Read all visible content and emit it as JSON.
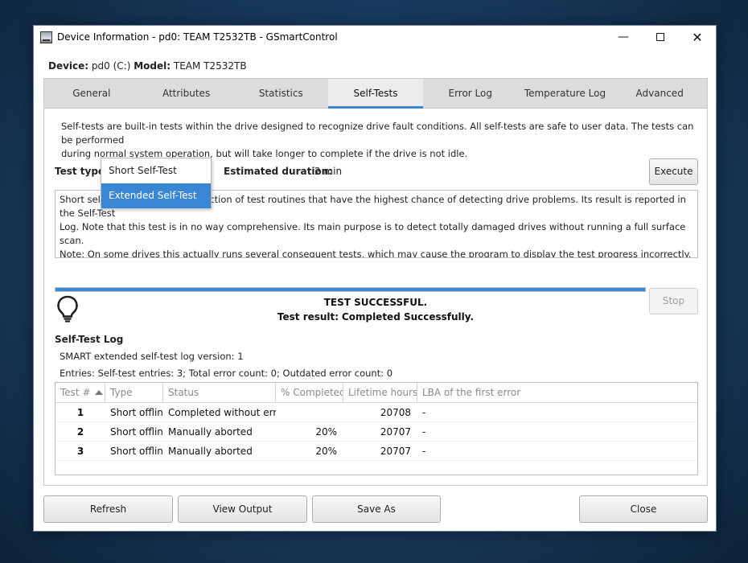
{
  "window": {
    "title": "Device Information - pd0: TEAM T2532TB - GSmartControl",
    "controls": {
      "minimize": "—",
      "close": "✕"
    }
  },
  "device": {
    "device_label": "Device:",
    "device_value": "pd0 (C:)",
    "model_label": "Model:",
    "model_value": "TEAM T2532TB"
  },
  "tabs": [
    {
      "label": "General"
    },
    {
      "label": "Attributes"
    },
    {
      "label": "Statistics"
    },
    {
      "label": "Self-Tests"
    },
    {
      "label": "Error Log"
    },
    {
      "label": "Temperature Log"
    },
    {
      "label": "Advanced"
    }
  ],
  "active_tab": "Self-Tests",
  "selftests": {
    "intro_line1": "Self-tests are built-in tests within the drive designed to recognize drive fault conditions. All self-tests are safe to user data. The tests can be performed",
    "intro_line2": "during normal system operation, but will take longer to complete if the drive is not idle.",
    "test_type_label": "Test type:",
    "duration_label": "Estimated duration:",
    "duration_value": "2 min",
    "dropdown_options": [
      "Short Self-Test",
      "Extended Self-Test"
    ],
    "dropdown_highlighted": "Extended Self-Test",
    "execute_label": "Execute",
    "stop_label": "Stop",
    "description_line1": "Short self-test consists of a collection of test routines that have the highest chance of detecting drive problems. Its result is reported in the Self-Test",
    "description_line2": "Log. Note that this test is in no way comprehensive. Its main purpose is to detect totally damaged drives without running a full surface scan.",
    "description_line3": "Note: On some drives this actually runs several consequent tests, which may cause the program to display the test progress incorrectly.",
    "progress_fraction": 1.0,
    "result_title": "TEST SUCCESSFUL.",
    "result_label": "Test result:",
    "result_value": "Completed Successfully."
  },
  "log": {
    "title": "Self-Test Log",
    "version_line": "SMART extended self-test log version: 1",
    "entries_line": "Entries: Self-test entries: 3; Total error count: 0; Outdated error count: 0",
    "columns": [
      "Test #",
      "Type",
      "Status",
      "% Completed",
      "Lifetime hours",
      "LBA of the first error"
    ],
    "rows": [
      {
        "num": "1",
        "type": "Short offline",
        "status": "Completed without error",
        "completed": "",
        "hours": "20708",
        "lba": "-"
      },
      {
        "num": "2",
        "type": "Short offline",
        "status": "Manually aborted",
        "completed": "20%",
        "hours": "20707",
        "lba": "-"
      },
      {
        "num": "3",
        "type": "Short offline",
        "status": "Manually aborted",
        "completed": "20%",
        "hours": "20707",
        "lba": "-"
      }
    ]
  },
  "buttons": {
    "refresh": "Refresh",
    "view_output": "View Output",
    "save_as": "Save As",
    "close": "Close"
  },
  "colors": {
    "accent": "#3a86d4",
    "tab_bar": "#dcdcdc"
  }
}
